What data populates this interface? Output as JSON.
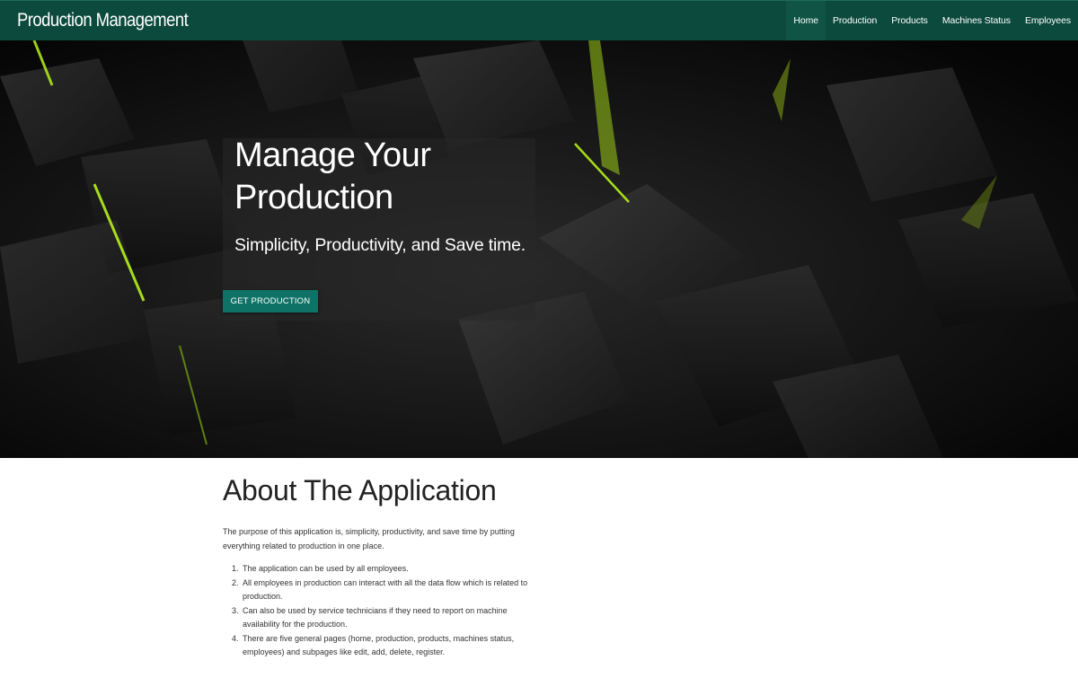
{
  "navbar": {
    "brand": "Production Management",
    "items": [
      {
        "label": "Home",
        "active": true
      },
      {
        "label": "Production",
        "active": false
      },
      {
        "label": "Products",
        "active": false
      },
      {
        "label": "Machines Status",
        "active": false
      },
      {
        "label": "Employees",
        "active": false
      }
    ]
  },
  "hero": {
    "title": "Manage Your Production",
    "subtitle": "Simplicity, Productivity, and Save time.",
    "button_label": "GET PRODUCTION",
    "accent_color": "#b6f21a",
    "button_color": "#0e7366"
  },
  "about": {
    "title": "About The Application",
    "intro": "The purpose of this application is, simplicity, productivity, and save time by putting everything related to production in one place.",
    "items": [
      {
        "num": "1.",
        "text": "The application can be used by all employees."
      },
      {
        "num": "2.",
        "text": "All employees in production can interact with all the data flow which is related to production."
      },
      {
        "num": "3.",
        "text": "Can also be used by service technicians if they need to report on machine availability for the production."
      },
      {
        "num": "4.",
        "text": "There are five general pages (home, production, products, machines status, employees) and subpages like edit, add, delete, register."
      }
    ]
  },
  "colors": {
    "navbar": "#0b4a3c"
  }
}
